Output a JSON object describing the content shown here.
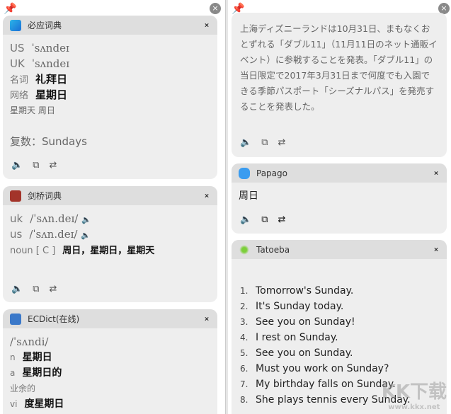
{
  "left": {
    "bing": {
      "title": "必应词典",
      "us_label": "US",
      "us_phon": "ˈsʌndeɪ",
      "uk_label": "UK",
      "uk_phon": "ˈsʌndeɪ",
      "pos1": "名词",
      "def1": "礼拜日",
      "pos2": "网络",
      "def2": "星期日",
      "extra": "星期天 周日",
      "plural": "复数：Sundays"
    },
    "cambridge": {
      "title": "剑桥词典",
      "uk_label": "uk",
      "uk_phon": "/ˈsʌn.deɪ/",
      "us_label": "us",
      "us_phon": "/ˈsʌn.deɪ/",
      "pos": "noun [ C ]",
      "def": "周日，星期日，星期天"
    },
    "ecdict": {
      "title": "ECDict(在线)",
      "phon": "/ˈsʌndi/",
      "items": [
        {
          "pos": "n",
          "def": "星期日"
        },
        {
          "pos": "a",
          "def": "星期日的"
        }
      ],
      "note": "业余的",
      "vi_pos": "vi",
      "vi_def": "度星期日"
    }
  },
  "right": {
    "jp_text": "上海ディズニーランドは10月31日、まもなくおとずれる「ダブル11」（11月11日のネット通販イベント）に参戦することを発表。「ダブル11」の当日限定で2017年3月31日まで何度でも入園できる季節パスポート「シーズナルパス」を発売することを発表した。",
    "papago": {
      "title": "Papago",
      "result": "周日"
    },
    "tatoeba": {
      "title": "Tatoeba",
      "sentences": [
        {
          "n": "1.",
          "t": "Tomorrow's Sunday."
        },
        {
          "n": "2.",
          "t": "It's Sunday today."
        },
        {
          "n": "3.",
          "t": "See you on Sunday!"
        },
        {
          "n": "4.",
          "t": "I rest on Sunday."
        },
        {
          "n": "5.",
          "t": "See you on Sunday."
        },
        {
          "n": "6.",
          "t": "Must you work on Sunday?"
        },
        {
          "n": "7.",
          "t": "My birthday falls on Sunday."
        },
        {
          "n": "8.",
          "t": "She plays tennis every Sunday."
        }
      ]
    }
  },
  "icons": {
    "close": "×",
    "pin": "pin-icon",
    "fold": "fold-icon",
    "speaker": "🔈",
    "copy": "⧉",
    "swap": "⇄"
  },
  "watermark": {
    "main": "KK下载",
    "url": "www.kkx.net"
  }
}
